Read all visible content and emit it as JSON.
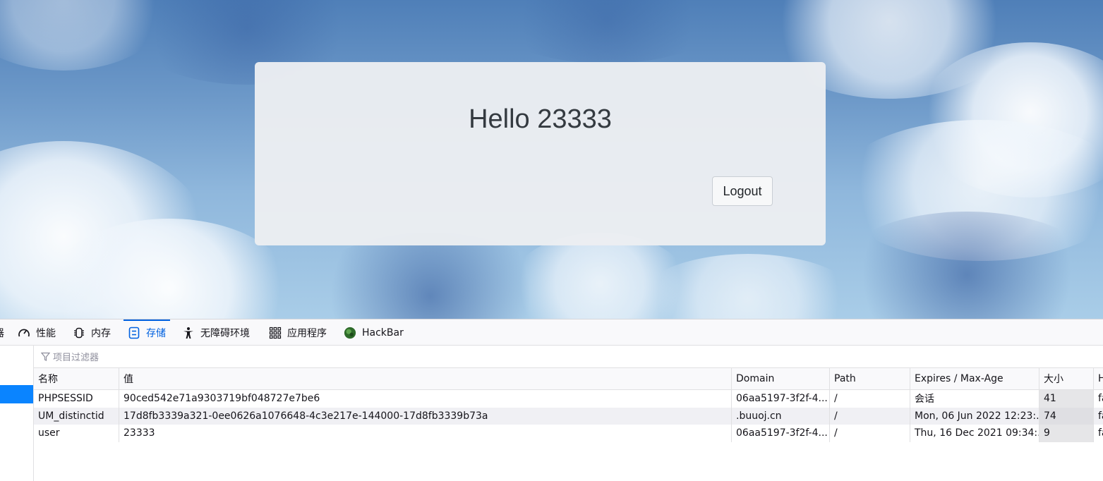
{
  "page": {
    "greeting": "Hello 23333",
    "logout_label": "Logout"
  },
  "devtools": {
    "tabs": [
      {
        "label": "器",
        "icon": "truncated-tab-icon"
      },
      {
        "label": "性能",
        "icon": "gauge-icon"
      },
      {
        "label": "内存",
        "icon": "memory-chip-icon"
      },
      {
        "label": "存储",
        "icon": "storage-icon",
        "active": true
      },
      {
        "label": "无障碍环境",
        "icon": "accessibility-icon"
      },
      {
        "label": "应用程序",
        "icon": "grid-icon"
      },
      {
        "label": "HackBar",
        "icon": "hackbar-icon"
      }
    ],
    "filter_placeholder": "项目过滤器",
    "columns": [
      "名称",
      "值",
      "Domain",
      "Path",
      "Expires / Max-Age",
      "大小",
      "H"
    ],
    "rows": [
      {
        "name": "PHPSESSID",
        "value": "90ced542e71a9303719bf048727e7be6",
        "domain": "06aa5197-3f2f-4...",
        "path": "/",
        "expires": "会话",
        "size": "41",
        "http": "fa"
      },
      {
        "name": "UM_distinctid",
        "value": "17d8fb3339a321-0ee0626a1076648-4c3e217e-144000-17d8fb3339b73a",
        "domain": ".buuoj.cn",
        "path": "/",
        "expires": "Mon, 06 Jun 2022 12:23:...",
        "size": "74",
        "http": "fa"
      },
      {
        "name": "user",
        "value": "23333",
        "domain": "06aa5197-3f2f-4...",
        "path": "/",
        "expires": "Thu, 16 Dec 2021 09:34:...",
        "size": "9",
        "http": "fa"
      }
    ],
    "accent_color": "#0061e0"
  }
}
